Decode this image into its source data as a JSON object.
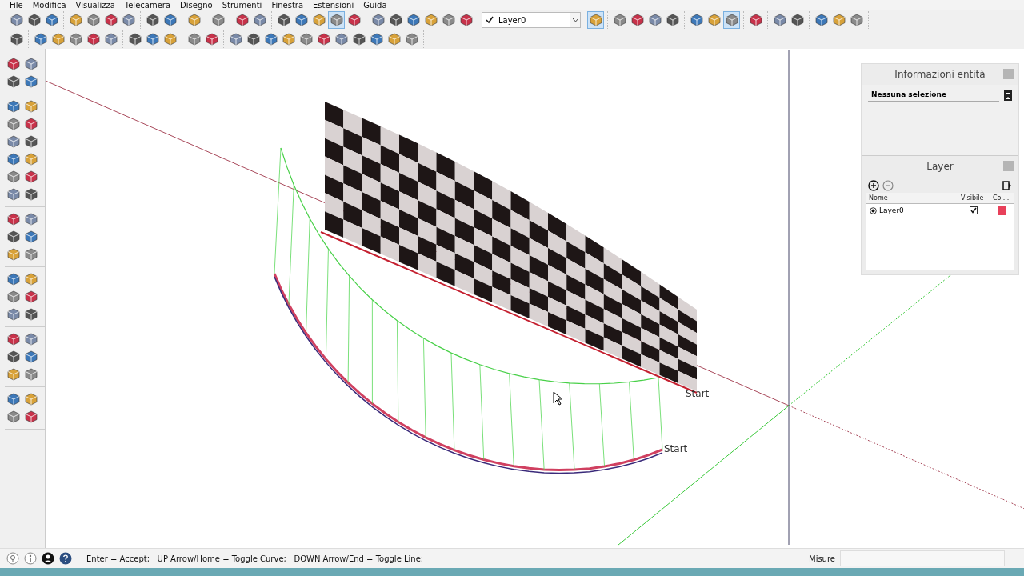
{
  "menu": [
    "File",
    "Modifica",
    "Visualizza",
    "Telecamera",
    "Disegno",
    "Strumenti",
    "Finestra",
    "Estensioni",
    "Guida"
  ],
  "toolbar_top": [
    [
      {
        "selected": false
      },
      {
        "selected": false
      },
      {
        "selected": false
      }
    ],
    [
      {
        "selected": false
      },
      {
        "selected": false
      },
      {
        "selected": false
      },
      {
        "selected": false
      }
    ],
    [
      {
        "selected": false
      },
      {
        "selected": false
      }
    ],
    [
      {
        "selected": false
      }
    ],
    [
      {
        "selected": false
      }
    ],
    [
      {
        "selected": false
      },
      {
        "selected": false
      }
    ],
    [
      {
        "selected": false
      },
      {
        "selected": false
      },
      {
        "selected": false
      },
      {
        "selected": true
      },
      {
        "selected": false
      }
    ],
    [
      {
        "selected": false
      },
      {
        "selected": false
      },
      {
        "selected": false
      },
      {
        "selected": false
      },
      {
        "selected": false
      },
      {
        "selected": false
      }
    ]
  ],
  "layer_dropdown": {
    "value": "Layer0"
  },
  "toolbar_top_right": [
    [
      {
        "selected": true
      }
    ],
    [
      {
        "selected": false
      },
      {
        "selected": false
      },
      {
        "selected": false
      },
      {
        "selected": false
      }
    ],
    [
      {
        "selected": false
      },
      {
        "selected": false
      },
      {
        "selected": true
      }
    ],
    [
      {
        "selected": false
      }
    ],
    [
      {
        "selected": false
      },
      {
        "selected": false
      }
    ],
    [
      {
        "selected": false
      },
      {
        "selected": false
      },
      {
        "selected": false
      }
    ]
  ],
  "toolbar_second": [
    [
      {
        "selected": false
      }
    ],
    [
      {
        "selected": false
      },
      {
        "selected": false
      },
      {
        "selected": false
      },
      {
        "selected": false
      },
      {
        "selected": false
      }
    ],
    [
      {
        "selected": false
      },
      {
        "selected": false
      },
      {
        "selected": false
      }
    ],
    [
      {
        "selected": false
      },
      {
        "selected": false
      }
    ],
    [
      {
        "selected": false
      },
      {
        "selected": false
      },
      {
        "selected": false
      },
      {
        "selected": false
      },
      {
        "selected": false
      },
      {
        "selected": false
      },
      {
        "selected": false
      },
      {
        "selected": false
      },
      {
        "selected": false
      },
      {
        "selected": false
      },
      {
        "selected": false
      }
    ]
  ],
  "canvas": {
    "labels": [
      "Start",
      "Start"
    ]
  },
  "entity_info": {
    "title": "Informazioni entità",
    "selection": "Nessuna selezione"
  },
  "layer_panel": {
    "title": "Layer",
    "columns": [
      "Nome",
      "Visibile",
      "Col..."
    ],
    "rows": [
      {
        "name": "Layer0",
        "current": true,
        "visible": true,
        "color": "#e8405a"
      }
    ]
  },
  "status_bar": {
    "hint": "Enter = Accept;   UP Arrow/Home = Toggle Curve;   DOWN Arrow/End = Toggle Line;",
    "measure_label": "Misure"
  }
}
